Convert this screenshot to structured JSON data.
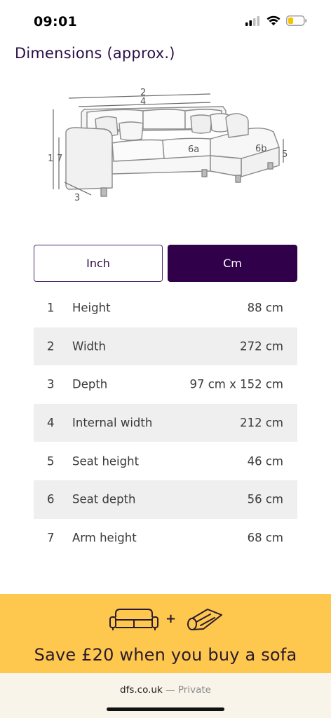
{
  "status_bar": {
    "time": "09:01"
  },
  "section": {
    "title": "Dimensions (approx.)"
  },
  "diagram": {
    "labels": {
      "top_outer": "2",
      "top_inner": "4",
      "left_height": "1",
      "left_arm": "7",
      "depth": "3",
      "seat_left": "6a",
      "seat_right": "6b",
      "right_height": "5"
    }
  },
  "unit_toggle": {
    "inch_label": "Inch",
    "cm_label": "Cm",
    "selected": "Cm"
  },
  "dimensions": [
    {
      "num": "1",
      "label": "Height",
      "value": "88 cm"
    },
    {
      "num": "2",
      "label": "Width",
      "value": "272 cm"
    },
    {
      "num": "3",
      "label": "Depth",
      "value": "97 cm x 152 cm"
    },
    {
      "num": "4",
      "label": "Internal width",
      "value": "212 cm"
    },
    {
      "num": "5",
      "label": "Seat height",
      "value": "46 cm"
    },
    {
      "num": "6",
      "label": "Seat depth",
      "value": "56 cm"
    },
    {
      "num": "7",
      "label": "Arm height",
      "value": "68 cm"
    }
  ],
  "promo": {
    "text": "Save £20 when you buy a sofa",
    "plus": "+"
  },
  "browser": {
    "domain": "dfs.co.uk",
    "separator": " — ",
    "mode": "Private"
  },
  "colors": {
    "brand_purple": "#31004a",
    "promo_yellow": "#fdc84d",
    "title_purple": "#2b0f47"
  }
}
